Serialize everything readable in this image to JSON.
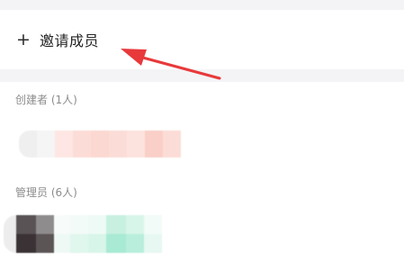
{
  "invite": {
    "plus": "+",
    "label": "邀请成员"
  },
  "sections": {
    "creator_label": "创建者 (1人)",
    "admin_label": "管理员 (6人)"
  },
  "annotation": {
    "arrow_color": "#e8393b"
  }
}
